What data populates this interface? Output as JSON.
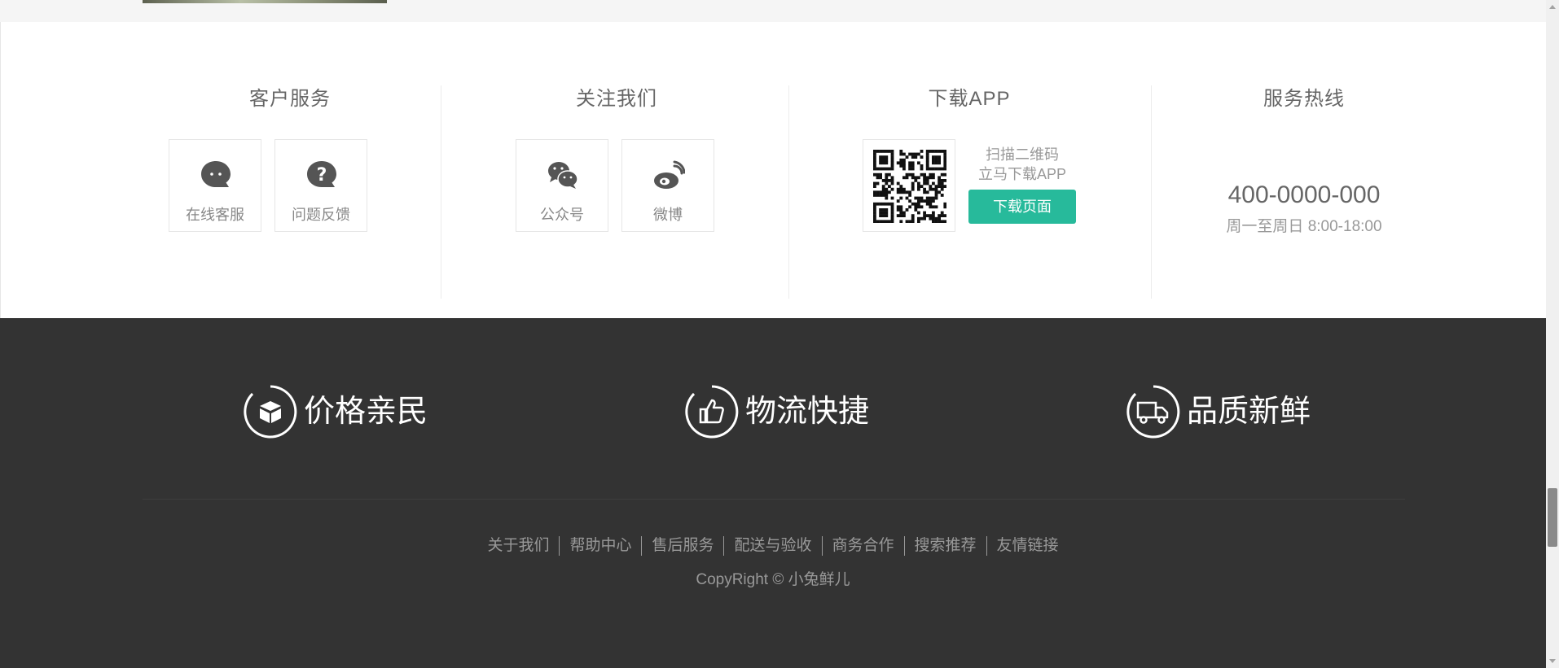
{
  "services": {
    "customer": {
      "title": "客户服务",
      "items": [
        {
          "label": "在线客服",
          "icon": "chat-bubble-icon"
        },
        {
          "label": "问题反馈",
          "icon": "question-bubble-icon"
        }
      ]
    },
    "follow": {
      "title": "关注我们",
      "items": [
        {
          "label": "公众号",
          "icon": "wechat-icon"
        },
        {
          "label": "微博",
          "icon": "weibo-icon"
        }
      ]
    },
    "app": {
      "title": "下载APP",
      "qr_line1": "扫描二维码",
      "qr_line2": "立马下载APP",
      "button": "下载页面"
    },
    "hotline": {
      "title": "服务热线",
      "number": "400-0000-000",
      "hours": "周一至周日 8:00-18:00"
    }
  },
  "features": [
    {
      "label": "价格亲民",
      "icon": "box-icon"
    },
    {
      "label": "物流快捷",
      "icon": "thumbs-up-icon"
    },
    {
      "label": "品质新鲜",
      "icon": "truck-icon"
    }
  ],
  "footer_links": [
    "关于我们",
    "帮助中心",
    "售后服务",
    "配送与验收",
    "商务合作",
    "搜索推荐",
    "友情链接"
  ],
  "copyright": "CopyRight © 小兔鲜儿",
  "colors": {
    "accent": "#27ba9b",
    "footer_bg": "#333333"
  }
}
